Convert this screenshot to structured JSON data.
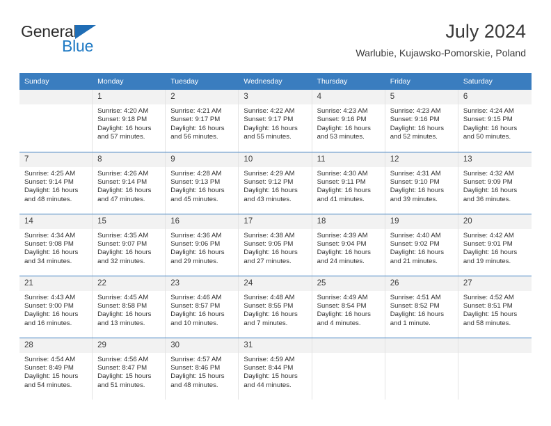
{
  "brand": {
    "name_part1": "General",
    "name_part2": "Blue",
    "triangle_color": "#1f6db5",
    "blue_color": "#1f7ac4"
  },
  "header": {
    "title": "July 2024",
    "subtitle": "Warlubie, Kujawsko-Pomorskie, Poland"
  },
  "theme": {
    "header_blue": "#3a7dbf",
    "daynum_band": "#f2f2f2",
    "text": "#2f2f2f"
  },
  "weekday_headers": [
    "Sunday",
    "Monday",
    "Tuesday",
    "Wednesday",
    "Thursday",
    "Friday",
    "Saturday"
  ],
  "weeks": [
    [
      {
        "day": "",
        "sunrise": "",
        "sunset": "",
        "daylight": "",
        "empty": true
      },
      {
        "day": "1",
        "sunrise": "Sunrise: 4:20 AM",
        "sunset": "Sunset: 9:18 PM",
        "daylight": "Daylight: 16 hours and 57 minutes."
      },
      {
        "day": "2",
        "sunrise": "Sunrise: 4:21 AM",
        "sunset": "Sunset: 9:17 PM",
        "daylight": "Daylight: 16 hours and 56 minutes."
      },
      {
        "day": "3",
        "sunrise": "Sunrise: 4:22 AM",
        "sunset": "Sunset: 9:17 PM",
        "daylight": "Daylight: 16 hours and 55 minutes."
      },
      {
        "day": "4",
        "sunrise": "Sunrise: 4:23 AM",
        "sunset": "Sunset: 9:16 PM",
        "daylight": "Daylight: 16 hours and 53 minutes."
      },
      {
        "day": "5",
        "sunrise": "Sunrise: 4:23 AM",
        "sunset": "Sunset: 9:16 PM",
        "daylight": "Daylight: 16 hours and 52 minutes."
      },
      {
        "day": "6",
        "sunrise": "Sunrise: 4:24 AM",
        "sunset": "Sunset: 9:15 PM",
        "daylight": "Daylight: 16 hours and 50 minutes."
      }
    ],
    [
      {
        "day": "7",
        "sunrise": "Sunrise: 4:25 AM",
        "sunset": "Sunset: 9:14 PM",
        "daylight": "Daylight: 16 hours and 48 minutes."
      },
      {
        "day": "8",
        "sunrise": "Sunrise: 4:26 AM",
        "sunset": "Sunset: 9:14 PM",
        "daylight": "Daylight: 16 hours and 47 minutes."
      },
      {
        "day": "9",
        "sunrise": "Sunrise: 4:28 AM",
        "sunset": "Sunset: 9:13 PM",
        "daylight": "Daylight: 16 hours and 45 minutes."
      },
      {
        "day": "10",
        "sunrise": "Sunrise: 4:29 AM",
        "sunset": "Sunset: 9:12 PM",
        "daylight": "Daylight: 16 hours and 43 minutes."
      },
      {
        "day": "11",
        "sunrise": "Sunrise: 4:30 AM",
        "sunset": "Sunset: 9:11 PM",
        "daylight": "Daylight: 16 hours and 41 minutes."
      },
      {
        "day": "12",
        "sunrise": "Sunrise: 4:31 AM",
        "sunset": "Sunset: 9:10 PM",
        "daylight": "Daylight: 16 hours and 39 minutes."
      },
      {
        "day": "13",
        "sunrise": "Sunrise: 4:32 AM",
        "sunset": "Sunset: 9:09 PM",
        "daylight": "Daylight: 16 hours and 36 minutes."
      }
    ],
    [
      {
        "day": "14",
        "sunrise": "Sunrise: 4:34 AM",
        "sunset": "Sunset: 9:08 PM",
        "daylight": "Daylight: 16 hours and 34 minutes."
      },
      {
        "day": "15",
        "sunrise": "Sunrise: 4:35 AM",
        "sunset": "Sunset: 9:07 PM",
        "daylight": "Daylight: 16 hours and 32 minutes."
      },
      {
        "day": "16",
        "sunrise": "Sunrise: 4:36 AM",
        "sunset": "Sunset: 9:06 PM",
        "daylight": "Daylight: 16 hours and 29 minutes."
      },
      {
        "day": "17",
        "sunrise": "Sunrise: 4:38 AM",
        "sunset": "Sunset: 9:05 PM",
        "daylight": "Daylight: 16 hours and 27 minutes."
      },
      {
        "day": "18",
        "sunrise": "Sunrise: 4:39 AM",
        "sunset": "Sunset: 9:04 PM",
        "daylight": "Daylight: 16 hours and 24 minutes."
      },
      {
        "day": "19",
        "sunrise": "Sunrise: 4:40 AM",
        "sunset": "Sunset: 9:02 PM",
        "daylight": "Daylight: 16 hours and 21 minutes."
      },
      {
        "day": "20",
        "sunrise": "Sunrise: 4:42 AM",
        "sunset": "Sunset: 9:01 PM",
        "daylight": "Daylight: 16 hours and 19 minutes."
      }
    ],
    [
      {
        "day": "21",
        "sunrise": "Sunrise: 4:43 AM",
        "sunset": "Sunset: 9:00 PM",
        "daylight": "Daylight: 16 hours and 16 minutes."
      },
      {
        "day": "22",
        "sunrise": "Sunrise: 4:45 AM",
        "sunset": "Sunset: 8:58 PM",
        "daylight": "Daylight: 16 hours and 13 minutes."
      },
      {
        "day": "23",
        "sunrise": "Sunrise: 4:46 AM",
        "sunset": "Sunset: 8:57 PM",
        "daylight": "Daylight: 16 hours and 10 minutes."
      },
      {
        "day": "24",
        "sunrise": "Sunrise: 4:48 AM",
        "sunset": "Sunset: 8:55 PM",
        "daylight": "Daylight: 16 hours and 7 minutes."
      },
      {
        "day": "25",
        "sunrise": "Sunrise: 4:49 AM",
        "sunset": "Sunset: 8:54 PM",
        "daylight": "Daylight: 16 hours and 4 minutes."
      },
      {
        "day": "26",
        "sunrise": "Sunrise: 4:51 AM",
        "sunset": "Sunset: 8:52 PM",
        "daylight": "Daylight: 16 hours and 1 minute."
      },
      {
        "day": "27",
        "sunrise": "Sunrise: 4:52 AM",
        "sunset": "Sunset: 8:51 PM",
        "daylight": "Daylight: 15 hours and 58 minutes."
      }
    ],
    [
      {
        "day": "28",
        "sunrise": "Sunrise: 4:54 AM",
        "sunset": "Sunset: 8:49 PM",
        "daylight": "Daylight: 15 hours and 54 minutes."
      },
      {
        "day": "29",
        "sunrise": "Sunrise: 4:56 AM",
        "sunset": "Sunset: 8:47 PM",
        "daylight": "Daylight: 15 hours and 51 minutes."
      },
      {
        "day": "30",
        "sunrise": "Sunrise: 4:57 AM",
        "sunset": "Sunset: 8:46 PM",
        "daylight": "Daylight: 15 hours and 48 minutes."
      },
      {
        "day": "31",
        "sunrise": "Sunrise: 4:59 AM",
        "sunset": "Sunset: 8:44 PM",
        "daylight": "Daylight: 15 hours and 44 minutes."
      },
      {
        "day": "",
        "sunrise": "",
        "sunset": "",
        "daylight": "",
        "empty": true
      },
      {
        "day": "",
        "sunrise": "",
        "sunset": "",
        "daylight": "",
        "empty": true
      },
      {
        "day": "",
        "sunrise": "",
        "sunset": "",
        "daylight": "",
        "empty": true
      }
    ]
  ]
}
